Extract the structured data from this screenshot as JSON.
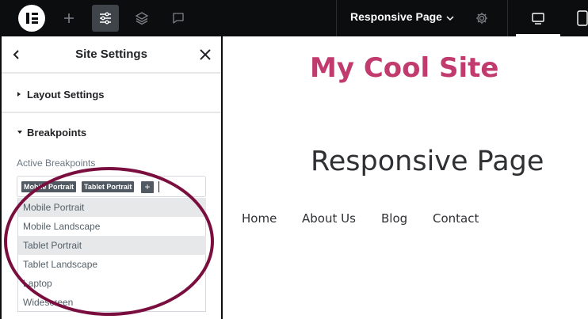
{
  "topbar": {
    "page_title": "Responsive Page",
    "icons": [
      "elementor-logo-icon",
      "plus-icon",
      "sliders-icon",
      "layers-icon",
      "chat-icon",
      "chevron-down-icon",
      "gear-icon",
      "desktop-icon",
      "tablet-icon"
    ]
  },
  "panel": {
    "title": "Site Settings",
    "sections": [
      {
        "label": "Layout Settings",
        "expanded": false
      },
      {
        "label": "Breakpoints",
        "expanded": true
      }
    ],
    "active_breakpoints_label": "Active Breakpoints",
    "selected_tags": [
      "Mobile Portrait",
      "Tablet Portrait"
    ],
    "add_tag_symbol": "+",
    "dropdown_options": [
      {
        "label": "Mobile Portrait",
        "highlighted": true
      },
      {
        "label": "Mobile Landscape",
        "highlighted": false
      },
      {
        "label": "Tablet Portrait",
        "highlighted": true
      },
      {
        "label": "Tablet Landscape",
        "highlighted": false
      },
      {
        "label": "Laptop",
        "highlighted": false
      },
      {
        "label": "Widescreen",
        "highlighted": false
      }
    ]
  },
  "canvas": {
    "site_title": "My Cool Site",
    "page_heading": "Responsive Page",
    "nav": [
      "Home",
      "About Us",
      "Blog",
      "Contact"
    ]
  },
  "colors": {
    "topbar_bg": "#0c0d0e",
    "accent_pink": "#c13b6e",
    "annotation_ellipse": "#7a0f3f",
    "tag_bg": "#515962"
  }
}
